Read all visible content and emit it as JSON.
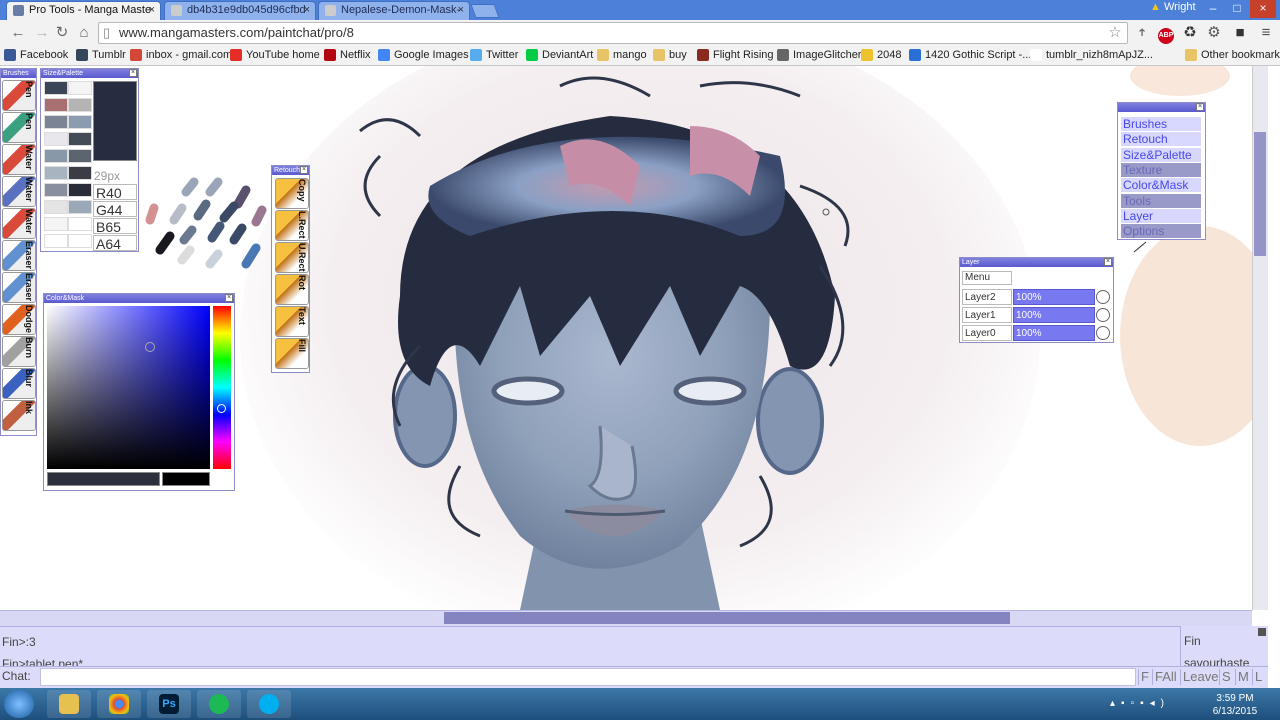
{
  "browser": {
    "tabs": [
      {
        "title": "Pro Tools - Manga Maste",
        "active": true
      },
      {
        "title": "db4b31e9db045d96cfbd",
        "active": false
      },
      {
        "title": "Nepalese-Demon-Mask-",
        "active": false
      }
    ],
    "user": "Wright",
    "url": "www.mangamasters.com/paintchat/pro/8",
    "bookmarks": [
      {
        "label": "Facebook",
        "color": "#3b5998"
      },
      {
        "label": "Tumblr",
        "color": "#35465c"
      },
      {
        "label": "inbox - gmail.com",
        "color": "#d44638"
      },
      {
        "label": "YouTube home",
        "color": "#e52d27"
      },
      {
        "label": "Netflix",
        "color": "#b20710"
      },
      {
        "label": "Google Images",
        "color": "#4285f4"
      },
      {
        "label": "Twitter",
        "color": "#55acee"
      },
      {
        "label": "DeviantArt",
        "color": "#05cc47"
      },
      {
        "label": "mango",
        "color": "#e8c466"
      },
      {
        "label": "buy",
        "color": "#e8c466"
      },
      {
        "label": "Flight Rising",
        "color": "#8a2b1f"
      },
      {
        "label": "ImageGlitcher",
        "color": "#666666"
      },
      {
        "label": "2048",
        "color": "#edc22e"
      },
      {
        "label": "1420 Gothic Script -...",
        "color": "#2a6fd6"
      },
      {
        "label": "tumblr_nizh8mApJZ...",
        "color": "#ffffff"
      },
      {
        "label": "Other bookmarks",
        "color": "#e8c466"
      }
    ]
  },
  "panels": {
    "brushes": {
      "title": "Brushes",
      "items": [
        "Pen",
        "Pen",
        "Water",
        "Water",
        "Water",
        "Eraser",
        "Eraser",
        "Dodge",
        "Burn",
        "Blur",
        "Ink"
      ]
    },
    "size_palette": {
      "title": "Size&Palette",
      "size": "29px",
      "r": "R40",
      "g": "G44",
      "b": "B65",
      "a": "A64",
      "swatches": [
        "#3d4656",
        "#f4f4f4",
        "#a87070",
        "#b4b4b4",
        "#7a8494",
        "#8c9cb0",
        "#e8e8ec",
        "#444c58",
        "#8898a8",
        "#5c6470",
        "#a8b4c0",
        "#3c3c44",
        "#8890a0",
        "#2a2c38",
        "#e4e4e4",
        "#9aa8b8",
        "#f4f4f4",
        "#ffffff",
        "#ffffff",
        "#ffffff"
      ],
      "current": "#282c41"
    },
    "retouch": {
      "title": "Retouch",
      "items": [
        "Copy",
        "L.Rect",
        "U.Rect",
        "Rot",
        "Text",
        "Fill"
      ]
    },
    "color_mask": {
      "title": "Color&Mask"
    },
    "window_list": {
      "items": [
        {
          "label": "Brushes",
          "active": true
        },
        {
          "label": "Retouch",
          "active": true
        },
        {
          "label": "Size&Palette",
          "active": true
        },
        {
          "label": "Texture",
          "active": false
        },
        {
          "label": "Color&Mask",
          "active": true
        },
        {
          "label": "Tools",
          "active": false
        },
        {
          "label": "Layer",
          "active": true
        },
        {
          "label": "Options",
          "active": false
        }
      ]
    },
    "layer": {
      "title": "Layer",
      "menu": "Menu",
      "layers": [
        {
          "name": "Layer2",
          "opacity": "100%"
        },
        {
          "name": "Layer1",
          "opacity": "100%"
        },
        {
          "name": "Layer0",
          "opacity": "100%"
        }
      ]
    }
  },
  "chat": {
    "log": [
      "Fin>:3",
      "Fin>tablet pen*"
    ],
    "users": [
      "Fin",
      "savourhaste"
    ],
    "label": "Chat:",
    "buttons": [
      "F",
      "FAll",
      "Leave",
      "S",
      "M",
      "L"
    ]
  },
  "taskbar": {
    "time": "3:59 PM",
    "date": "6/13/2015"
  }
}
